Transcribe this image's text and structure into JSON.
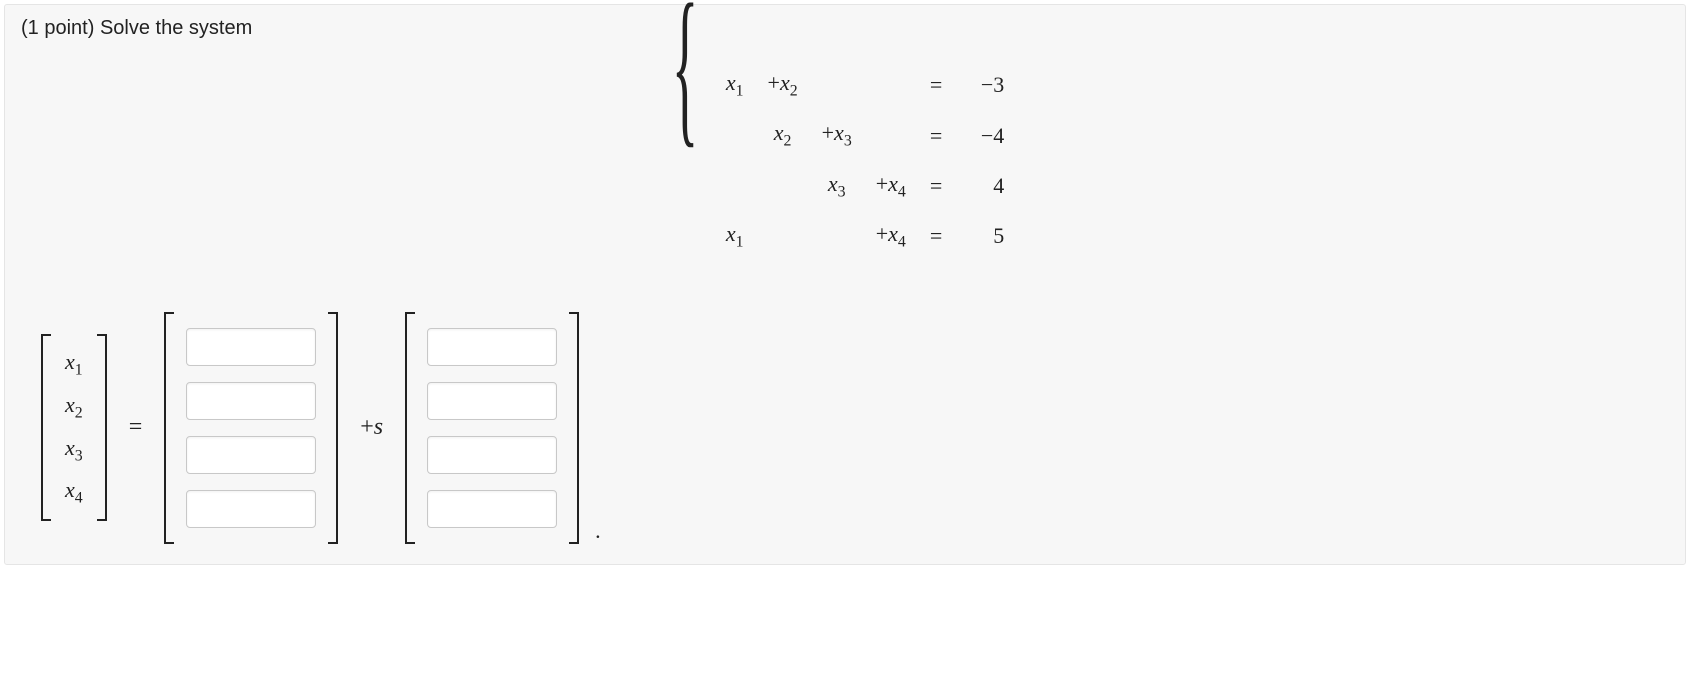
{
  "prompt": {
    "points_label": "(1 point)",
    "text": "Solve the system"
  },
  "system": {
    "rows": [
      {
        "c1": "x₁",
        "c2": "+x₂",
        "c3": "",
        "c4": "",
        "eq": "=",
        "rhs": "−3"
      },
      {
        "c1": "",
        "c2": "x₂",
        "c3": "+x₃",
        "c4": "",
        "eq": "=",
        "rhs": "−4"
      },
      {
        "c1": "",
        "c2": "",
        "c3": "x₃",
        "c4": "+x₄",
        "eq": "=",
        "rhs": "4"
      },
      {
        "c1": "x₁",
        "c2": "",
        "c3": "",
        "c4": "+x₄",
        "eq": "=",
        "rhs": "5"
      }
    ]
  },
  "answer": {
    "vars": [
      "x₁",
      "x₂",
      "x₃",
      "x₄"
    ],
    "eq": "=",
    "plus_s": "+s",
    "period": ".",
    "vec_a": [
      "",
      "",
      "",
      ""
    ],
    "vec_b": [
      "",
      "",
      "",
      ""
    ]
  }
}
